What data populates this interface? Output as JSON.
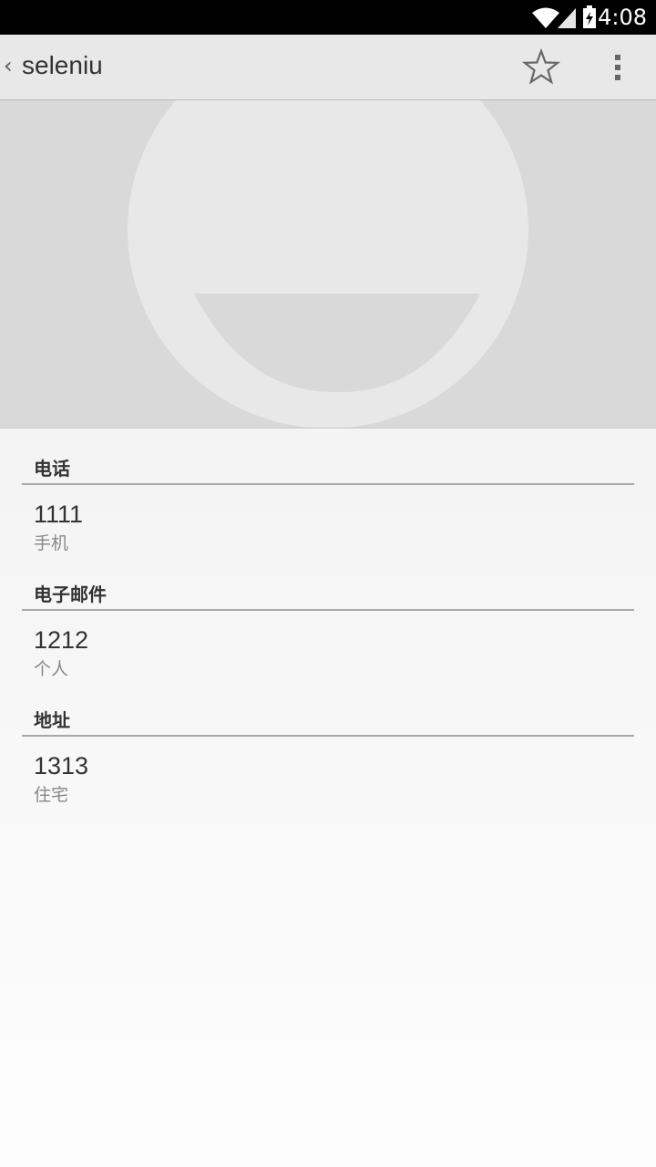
{
  "status_bar": {
    "time": "4:08",
    "icons": [
      "wifi-icon",
      "signal-icon",
      "battery-charging-icon"
    ]
  },
  "action_bar": {
    "back_caret": "‹",
    "title": "seleniu",
    "icons": [
      "star-outline-icon",
      "overflow-menu-icon"
    ]
  },
  "photo": {
    "icon": "default-contact-avatar-icon",
    "colors": {
      "background": "#d9d9d9",
      "face": "#e8e8e8"
    }
  },
  "sections": [
    {
      "header": "电话",
      "value": "1111",
      "type": "手机"
    },
    {
      "header": "电子邮件",
      "value": "1212",
      "type": "个人"
    },
    {
      "header": "地址",
      "value": "1313",
      "type": "住宅"
    }
  ]
}
